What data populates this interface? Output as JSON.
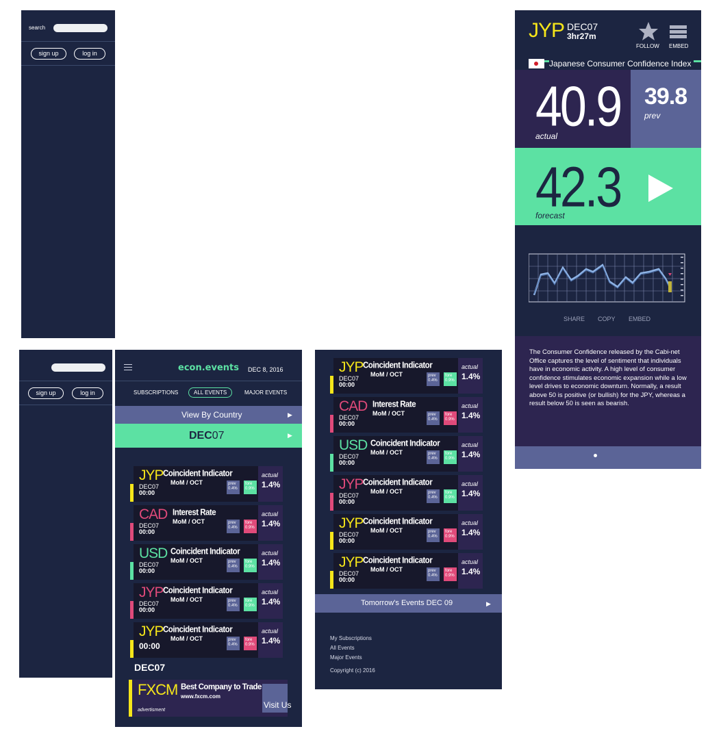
{
  "panel1": {
    "search_label": "search",
    "signup": "sign up",
    "login": "log in"
  },
  "panel2": {
    "signup": "sign up",
    "login": "log in"
  },
  "main": {
    "logo": "econ.events",
    "date": "DEC 8, 2016",
    "tabs": [
      "SUBSCRIPTIONS",
      "ALL EVENTS",
      "MAJOR EVENTS"
    ],
    "view_by_country": "View By Country",
    "day_bold": "DEC",
    "day_num": "07",
    "section_label": "DEC07",
    "ad": {
      "brand": "FXCM",
      "title": "Best Company to Trade",
      "url": "www.fxcm.com",
      "label": "advertisment",
      "cta": "Visit Us"
    }
  },
  "events_main": [
    {
      "currency": "JYP",
      "title": "Coincident Indicator",
      "sub": "MoM / OCT",
      "date": "DEC07",
      "time": "00:00",
      "prev": "prev",
      "prev_val": "0.4%",
      "fore": "fore",
      "fore_val": "0.9%",
      "actual": "actual",
      "actual_val": "1.4%",
      "color": "#f5e51a",
      "fore_color": "#5ce1a3"
    },
    {
      "currency": "CAD",
      "title": "Interest Rate",
      "sub": "MoM / OCT",
      "date": "DEC07",
      "time": "00:00",
      "prev": "prev",
      "prev_val": "0.4%",
      "fore": "fore",
      "fore_val": "0.9%",
      "actual": "actual",
      "actual_val": "1.4%",
      "color": "#e04a7a",
      "fore_color": "#e04a7a"
    },
    {
      "currency": "USD",
      "title": "Coincident Indicator",
      "sub": "MoM / OCT",
      "date": "DEC07",
      "time": "00:00",
      "prev": "prev",
      "prev_val": "0.4%",
      "fore": "fore",
      "fore_val": "0.9%",
      "actual": "actual",
      "actual_val": "1.4%",
      "color": "#5ce1a3",
      "fore_color": "#5ce1a3"
    },
    {
      "currency": "JYP",
      "title": "Coincident Indicator",
      "sub": "MoM / OCT",
      "date": "DEC07",
      "time": "00:00",
      "prev": "prev",
      "prev_val": "0.4%",
      "fore": "fore",
      "fore_val": "0.9%",
      "actual": "actual",
      "actual_val": "1.4%",
      "color": "#e04a7a",
      "fore_color": "#5ce1a3"
    },
    {
      "currency": "JYP",
      "title": "Coincident Indicator",
      "sub": "MoM / OCT",
      "date": "",
      "time": "00:00",
      "prev": "prev",
      "prev_val": "0.4%",
      "fore": "fore",
      "fore_val": "0.9%",
      "actual": "actual",
      "actual_val": "1.4%",
      "color": "#f5e51a",
      "fore_color": "#e04a7a"
    }
  ],
  "events_list": [
    {
      "currency": "JYP",
      "title": "Coincident Indicator",
      "sub": "MoM / OCT",
      "date": "DEC07",
      "time": "00:00",
      "prev": "prev",
      "prev_val": "0.4%",
      "fore": "fore",
      "fore_val": "0.9%",
      "actual": "actual",
      "actual_val": "1.4%",
      "color": "#f5e51a",
      "fore_color": "#5ce1a3"
    },
    {
      "currency": "CAD",
      "title": "Interest Rate",
      "sub": "MoM / OCT",
      "date": "DEC07",
      "time": "00:00",
      "prev": "prev",
      "prev_val": "0.4%",
      "fore": "fore",
      "fore_val": "0.9%",
      "actual": "actual",
      "actual_val": "1.4%",
      "color": "#e04a7a",
      "fore_color": "#e04a7a"
    },
    {
      "currency": "USD",
      "title": "Coincident Indicator",
      "sub": "MoM / OCT",
      "date": "DEC07",
      "time": "00:00",
      "prev": "prev",
      "prev_val": "0.4%",
      "fore": "fore",
      "fore_val": "0.9%",
      "actual": "actual",
      "actual_val": "1.4%",
      "color": "#5ce1a3",
      "fore_color": "#5ce1a3"
    },
    {
      "currency": "JYP",
      "title": "Coincident Indicator",
      "sub": "MoM / OCT",
      "date": "DEC07",
      "time": "00:00",
      "prev": "prev",
      "prev_val": "0.4%",
      "fore": "fore",
      "fore_val": "0.9%",
      "actual": "actual",
      "actual_val": "1.4%",
      "color": "#e04a7a",
      "fore_color": "#5ce1a3"
    },
    {
      "currency": "JYP",
      "title": "Coincident Indicator",
      "sub": "MoM / OCT",
      "date": "DEC07",
      "time": "00:00",
      "prev": "prev",
      "prev_val": "0.4%",
      "fore": "fore",
      "fore_val": "0.9%",
      "actual": "actual",
      "actual_val": "1.4%",
      "color": "#f5e51a",
      "fore_color": "#e04a7a"
    },
    {
      "currency": "JYP",
      "title": "Coincident Indicator",
      "sub": "MoM / OCT",
      "date": "DEC07",
      "time": "00:00",
      "prev": "prev",
      "prev_val": "0.4%",
      "fore": "fore",
      "fore_val": "0.9%",
      "actual": "actual",
      "actual_val": "1.4%",
      "color": "#f5e51a",
      "fore_color": "#e04a7a"
    }
  ],
  "list_panel": {
    "tomorrow": "Tomorrow's Events DEC 09",
    "links": [
      "My Subscriptions",
      "All Events",
      "Major Events"
    ],
    "copyright": "Copyright (c) 2016"
  },
  "detail": {
    "currency": "JYP",
    "date": "DEC07",
    "countdown": "3hr27m",
    "follow": "FOLLOW",
    "embed": "EMBED",
    "event_name": "Japanese Consumer Confidence Index",
    "actual_val": "40.9",
    "actual_lbl": "actual",
    "prev_val": "39.8",
    "prev_lbl": "prev",
    "forecast_val": "42.3",
    "forecast_lbl": "forecast",
    "actions": [
      "SHARE",
      "COPY",
      "EMBED"
    ],
    "description": "The Consumer Confidence released by the Cabi-net Office captures the level of sentiment that individuals have in economic activity. A high level of consumer confidence stimulates economic expansion while a low level drives to economic downturn. Normally, a result above 50 is positive (or bullish) for the JPY, whereas a result below 50 is seen as bearish."
  },
  "colors": {
    "navy": "#1c2541",
    "purple": "#2d2550",
    "slate": "#5b6497",
    "green": "#5ce1a3",
    "pink": "#e04a7a",
    "yellow": "#f5e51a"
  }
}
